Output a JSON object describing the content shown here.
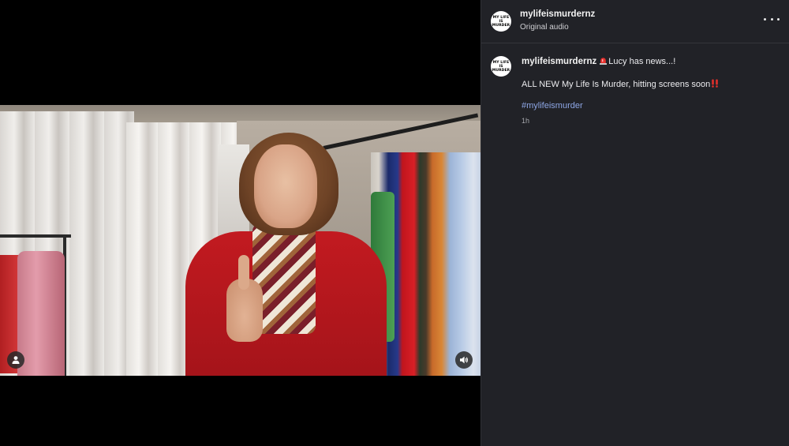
{
  "header": {
    "username": "mylifeismurdernz",
    "audio_label": "Original audio",
    "avatar_text": "MY LIFE IS MURDER"
  },
  "post": {
    "username": "mylifeismurdernz",
    "headline": "Lucy has news...!",
    "body": "ALL NEW My Life Is Murder, hitting screens soon",
    "hashtag": "#mylifeismurder",
    "timestamp": "1h"
  },
  "icons": {
    "tags": "person-icon",
    "volume": "speaker-icon",
    "more": "more-options-icon",
    "siren": "police-light-emoji",
    "exclamation": "double-exclamation-emoji"
  },
  "colors": {
    "panel_bg": "#212227",
    "hashtag": "#8ea7e6",
    "text": "#ececef"
  }
}
